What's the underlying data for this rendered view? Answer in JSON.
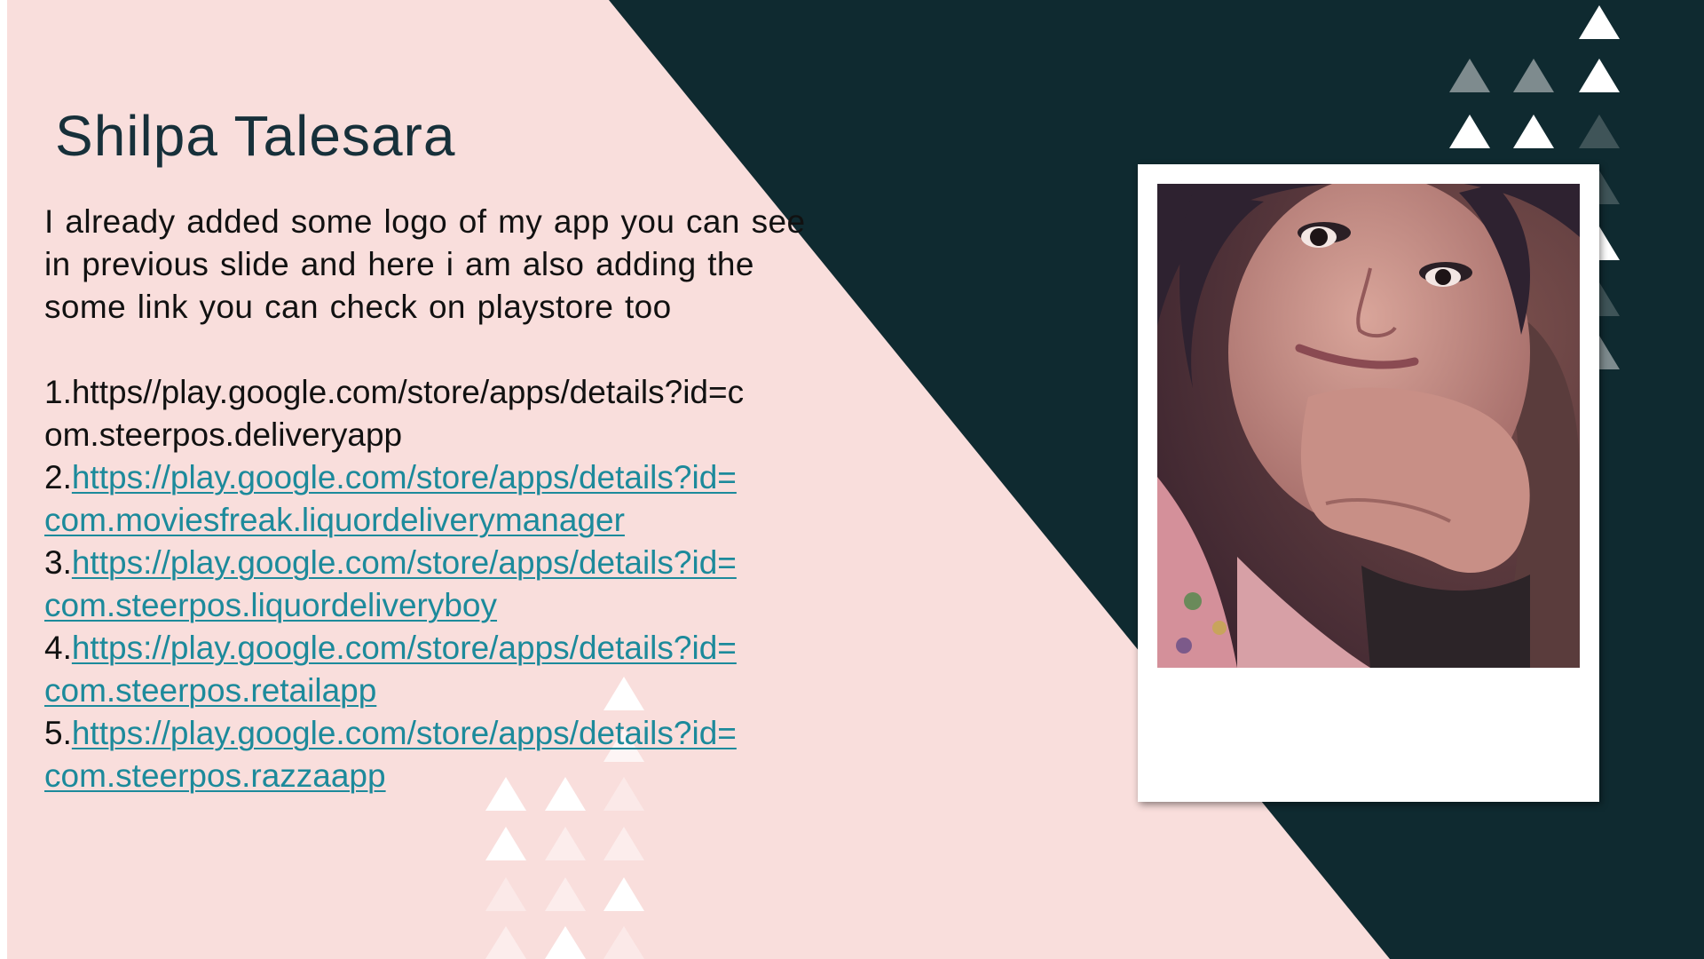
{
  "slide": {
    "title": "Shilpa Talesara",
    "intro": "I already added some logo of my app you can see in previous slide and here i am also adding the some link you can check on playstore too",
    "links": [
      {
        "number": "1.",
        "url_line1": "https//play.google.com/store/apps/details?id=c",
        "url_line2": "om.steerpos.deliveryapp",
        "hyperlinked": false
      },
      {
        "number": "2.",
        "url_line1": "https://play.google.com/store/apps/details?id=",
        "url_line2": "com.moviesfreak.liquordeliverymanager",
        "hyperlinked": true
      },
      {
        "number": "3.",
        "url_line1": "https://play.google.com/store/apps/details?id=",
        "url_line2": "com.steerpos.liquordeliveryboy",
        "hyperlinked": true
      },
      {
        "number": "4.",
        "url_line1": "https://play.google.com/store/apps/details?id=",
        "url_line2": "com.steerpos.retailapp",
        "hyperlinked": true
      },
      {
        "number": "5.",
        "url_line1": "https://play.google.com/store/apps/details?id=",
        "url_line2": "com.steerpos.razzaapp",
        "hyperlinked": true
      }
    ],
    "photo": {
      "icon": "portrait-photo"
    }
  },
  "colors": {
    "pink_background": "#f9dedc",
    "dark_background": "#0f2a30",
    "title_color": "#17303a",
    "link_color": "#1c8a9b"
  }
}
